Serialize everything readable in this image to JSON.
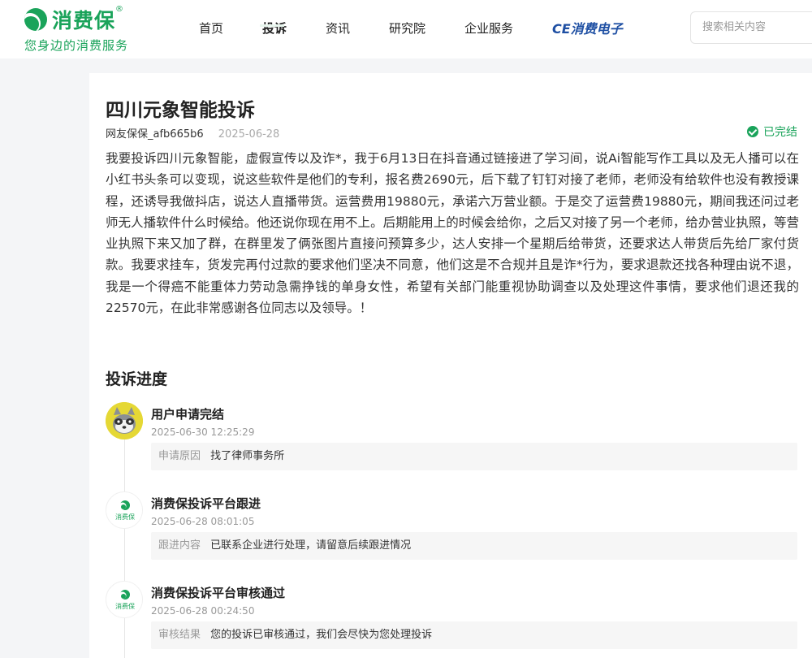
{
  "header": {
    "logo_name": "消费保",
    "logo_reg": "®",
    "slogan": "您身边的消费服务",
    "nav": [
      {
        "label": "首页",
        "active": false
      },
      {
        "label": "投诉",
        "active": true
      },
      {
        "label": "资讯",
        "active": false
      },
      {
        "label": "研究院",
        "active": false
      },
      {
        "label": "企业服务",
        "active": false
      }
    ],
    "ce_brand": "CE消费电子",
    "search_placeholder": "搜索相关内容"
  },
  "complaint": {
    "title": "四川元象智能投诉",
    "author": "网友保保_afb665b6",
    "date": "2025-06-28",
    "status": "已完结",
    "content": "我要投诉四川元象智能，虚假宣传以及诈*，我于6月13日在抖音通过链接进了学习间，说Ai智能写作工具以及无人播可以在小红书头条可以变现，说这些软件是他们的专利，报名费2690元，后下载了钉钉对接了老师，老师没有给软件也没有教授课程，还诱导我做抖店，说达人直播带货。运营费用19880元，承诺六万营业额。于是交了运营费19880元，期间我还问过老师无人播软件什么时候给。他还说你现在用不上。后期能用上的时候会给你，之后又对接了另一个老师，给办营业执照，等营业执照下来又加了群，在群里发了俩张图片直接问预算多少，达人安排一个星期后给带货，还要求达人带货后先给厂家付货款。我要求挂车，货发完再付过款的要求他们坚决不同意，他们这是不合规并且是诈*行为，要求退款还找各种理由说不退，我是一个得癌不能重体力劳动急需挣钱的单身女性，希望有关部门能重视协助调查以及处理这件事情，要求他们退还我的22570元，在此非常感谢各位同志以及领导。！"
  },
  "progress": {
    "section_title": "投诉进度",
    "items": [
      {
        "avatar": "raccoon-avatar",
        "title": "用户申请完结",
        "time": "2025-06-30 12:25:29",
        "label": "申请原因",
        "value": "找了律师事务所"
      },
      {
        "avatar": "platform-logo",
        "title": "消费保投诉平台跟进",
        "time": "2025-06-28 08:01:05",
        "label": "跟进内容",
        "value": "已联系企业进行处理，请留意后续跟进情况"
      },
      {
        "avatar": "platform-logo",
        "title": "消费保投诉平台审核通过",
        "time": "2025-06-28 00:24:50",
        "label": "审核结果",
        "value": "您的投诉已审核通过，我们会尽快为您处理投诉"
      }
    ],
    "platform_logo_text": "消费保"
  },
  "colors": {
    "brand": "#1aa35a",
    "ce_blue": "#1e4fa3"
  }
}
